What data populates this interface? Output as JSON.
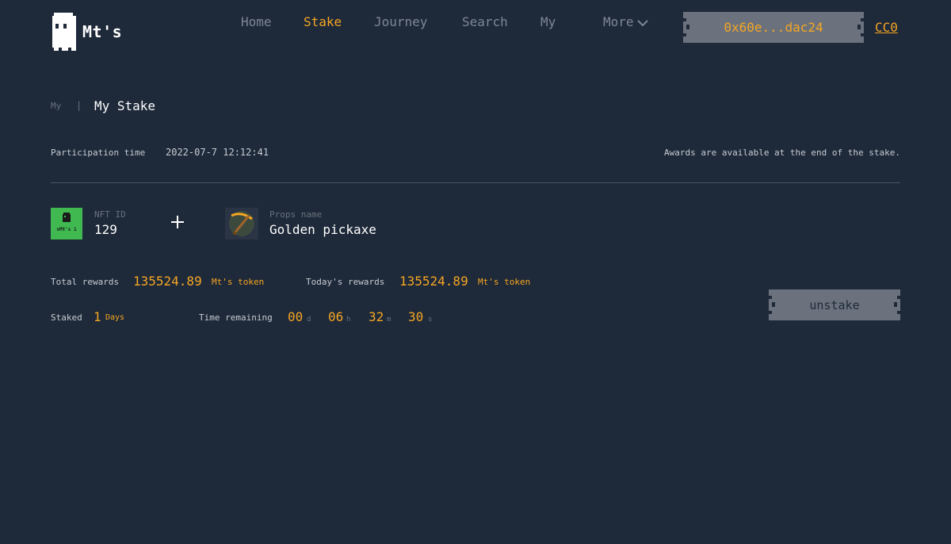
{
  "header": {
    "brand": "Mt's",
    "nav": [
      {
        "label": "Home",
        "active": false
      },
      {
        "label": "Stake",
        "active": true
      },
      {
        "label": "Journey",
        "active": false
      },
      {
        "label": "Search",
        "active": false
      },
      {
        "label": "My",
        "active": false
      },
      {
        "label": "More",
        "active": false
      }
    ],
    "wallet_address": "0x60e...dac24",
    "cc0_link": "CC0"
  },
  "breadcrumb": {
    "parent": "My",
    "separator": "|",
    "current": "My Stake"
  },
  "participation": {
    "label": "Participation time",
    "value": "2022-07-7 12:12:41",
    "note": "Awards are available at the end of the stake."
  },
  "nft": {
    "id_label": "NFT ID",
    "id_value": "129",
    "thumb_text": "vMt's 1",
    "props_label": "Props name",
    "props_value": "Golden pickaxe"
  },
  "rewards": {
    "total_label": "Total rewards",
    "total_value": "135524.89",
    "total_unit": "Mt's token",
    "today_label": "Today's rewards",
    "today_value": "135524.89",
    "today_unit": "Mt's token"
  },
  "stake": {
    "staked_label": "Staked",
    "staked_value": "1",
    "staked_unit": "Days",
    "remaining_label": "Time remaining",
    "days": "00",
    "days_unit": "d",
    "hours": "06",
    "hours_unit": "h",
    "minutes": "32",
    "minutes_unit": "m",
    "seconds": "30",
    "seconds_unit": "s"
  },
  "actions": {
    "unstake_label": "unstake"
  },
  "colors": {
    "background": "#1e2939",
    "accent": "#f5a623",
    "muted": "#6b727d",
    "nft_green": "#3fb950"
  }
}
